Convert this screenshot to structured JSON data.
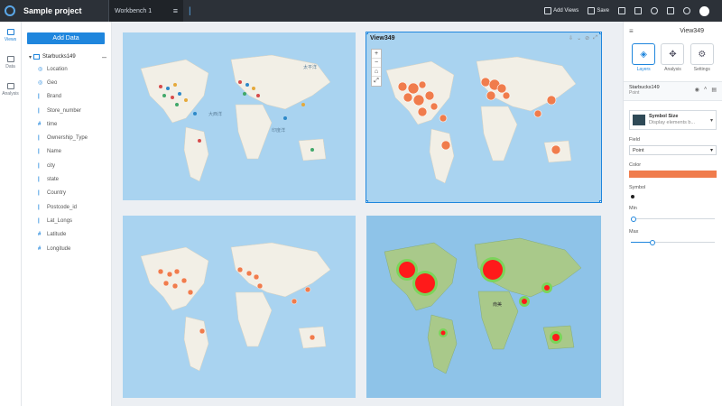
{
  "app": {
    "project_title": "Sample project"
  },
  "tabs": [
    {
      "label": "Workbench 1"
    }
  ],
  "toolbar": {
    "actions": [
      {
        "label": "Add Views",
        "icon": "add-view-icon"
      },
      {
        "label": "Save",
        "icon": "save-icon"
      }
    ],
    "icons": [
      "export-icon",
      "filter-icon",
      "move-icon",
      "grid-icon",
      "settings-icon",
      "user-avatar-icon"
    ]
  },
  "rail": {
    "items": [
      {
        "label": "Views",
        "icon": "views-icon",
        "active": true
      },
      {
        "label": "Data",
        "icon": "data-icon",
        "active": false
      },
      {
        "label": "Analysis",
        "icon": "analysis-icon",
        "active": false
      }
    ]
  },
  "data_panel": {
    "add_data_label": "Add Data",
    "dataset_name": "Starbucks149",
    "fields": [
      {
        "type": "geo",
        "name": "Location"
      },
      {
        "type": "geo",
        "name": "Geo"
      },
      {
        "type": "str",
        "name": "Brand"
      },
      {
        "type": "str",
        "name": "Store_number"
      },
      {
        "type": "num",
        "name": "time"
      },
      {
        "type": "str",
        "name": "Ownership_Type"
      },
      {
        "type": "str",
        "name": "Name"
      },
      {
        "type": "str",
        "name": "city"
      },
      {
        "type": "str",
        "name": "state"
      },
      {
        "type": "str",
        "name": "Country"
      },
      {
        "type": "str",
        "name": "Postcode_id"
      },
      {
        "type": "str",
        "name": "Lat_Longs"
      },
      {
        "type": "num",
        "name": "Latitude"
      },
      {
        "type": "num",
        "name": "Longitude"
      }
    ]
  },
  "views": {
    "active_title": "View349",
    "ocean_labels": {
      "north_atlantic": "大西洋",
      "north_pacific": "太平洋",
      "north_indian": "印度洋"
    },
    "zoom_controls": [
      "+",
      "−",
      "⌂",
      "⤢"
    ],
    "heatmap_label": "南美"
  },
  "right_panel": {
    "view_name": "View349",
    "tabs": [
      {
        "label": "Layers",
        "active": true
      },
      {
        "label": "Analysis",
        "active": false
      },
      {
        "label": "Settings",
        "active": false
      }
    ],
    "layer": {
      "name": "Starbucks149",
      "sub": "Point"
    },
    "symbol": {
      "title": "Symbol Size",
      "desc": "Display elements b..."
    },
    "type_label": "Field",
    "type_value": "Point",
    "color_label": "Color",
    "color_value": "#f07c4c",
    "symbol_label": "Symbol",
    "min_label": "Min",
    "max_label": "Max",
    "min_value": 0,
    "max_value": 0.25
  },
  "colors": {
    "accent": "#1f86dd",
    "point_orange": "#f07c4c",
    "heat_red": "#ff1a1a",
    "ocean": "#a9d3f0",
    "land": "#f2efe6"
  }
}
